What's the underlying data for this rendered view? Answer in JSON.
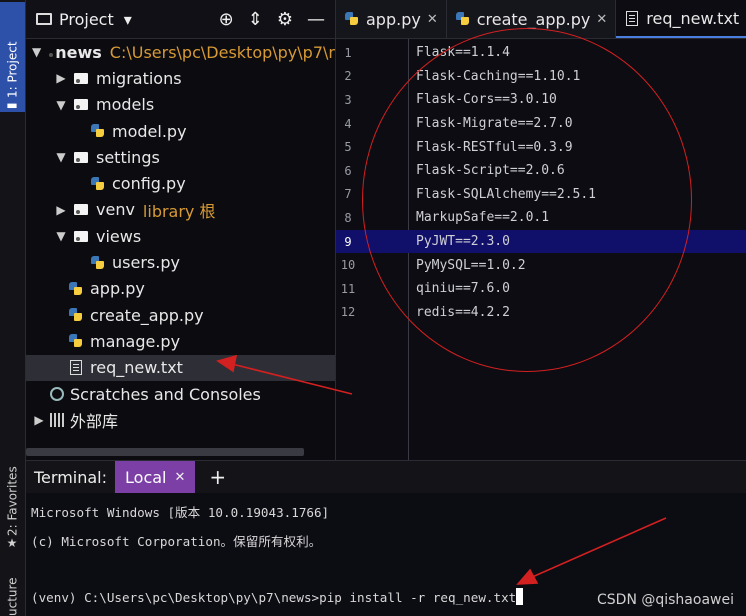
{
  "sidebar_strip": {
    "project_tab": "1: Project",
    "favorites_tab": "2: Favorites",
    "structure_tab": "ucture"
  },
  "project_panel": {
    "title": "Project",
    "dropdown_glyph": "▾",
    "tree": [
      {
        "name": "news",
        "path": "C:\\Users\\pc\\Desktop\\py\\p7\\n",
        "kind": "root",
        "expanded": true,
        "depth": 0
      },
      {
        "name": "migrations",
        "kind": "folder",
        "expanded": false,
        "depth": 1
      },
      {
        "name": "models",
        "kind": "folder",
        "expanded": true,
        "depth": 1
      },
      {
        "name": "model.py",
        "kind": "py",
        "depth": 2
      },
      {
        "name": "settings",
        "kind": "folder",
        "expanded": true,
        "depth": 1
      },
      {
        "name": "config.py",
        "kind": "py",
        "depth": 2
      },
      {
        "name": "venv",
        "note": "library 根",
        "kind": "folder",
        "expanded": false,
        "depth": 1
      },
      {
        "name": "views",
        "kind": "folder",
        "expanded": true,
        "depth": 1
      },
      {
        "name": "users.py",
        "kind": "py",
        "depth": 2
      },
      {
        "name": "app.py",
        "kind": "py",
        "depth": 1
      },
      {
        "name": "create_app.py",
        "kind": "py",
        "depth": 1
      },
      {
        "name": "manage.py",
        "kind": "py",
        "depth": 1
      },
      {
        "name": "req_new.txt",
        "kind": "txt",
        "depth": 1,
        "selected": true
      },
      {
        "name": "Scratches and Consoles",
        "kind": "scratch",
        "depth": 0
      },
      {
        "name": "外部库",
        "kind": "lib",
        "expanded": false,
        "depth": 0
      }
    ]
  },
  "editor_tabs": [
    {
      "label": "app.py",
      "icon": "python-file-icon",
      "active": false
    },
    {
      "label": "create_app.py",
      "icon": "python-file-icon",
      "active": false
    },
    {
      "label": "req_new.txt",
      "icon": "text-file-icon",
      "active": true
    }
  ],
  "editor": {
    "current_line": 9,
    "lines": [
      {
        "num": "1",
        "text": "Flask==1.1.4"
      },
      {
        "num": "2",
        "text": "Flask-Caching==1.10.1"
      },
      {
        "num": "3",
        "text": "Flask-Cors==3.0.10"
      },
      {
        "num": "4",
        "text": "Flask-Migrate==2.7.0"
      },
      {
        "num": "5",
        "text": "Flask-RESTful==0.3.9"
      },
      {
        "num": "6",
        "text": "Flask-Script==2.0.6"
      },
      {
        "num": "7",
        "text": "Flask-SQLAlchemy==2.5.1"
      },
      {
        "num": "8",
        "text": "MarkupSafe==2.0.1"
      },
      {
        "num": "9",
        "text": "PyJWT==2.3.0"
      },
      {
        "num": "10",
        "text": "PyMySQL==1.0.2"
      },
      {
        "num": "11",
        "text": "qiniu==7.6.0"
      },
      {
        "num": "12",
        "text": "redis==4.2.2"
      }
    ]
  },
  "terminal": {
    "label": "Terminal:",
    "tab": "Local",
    "add": "+",
    "lines": [
      "Microsoft Windows [版本 10.0.19043.1766]",
      "(c) Microsoft Corporation。保留所有权利。"
    ],
    "prompt": "(venv) C:\\Users\\pc\\Desktop\\py\\p7\\news>pip install -r req_new.txt"
  },
  "watermark": "CSDN @qishaoawei",
  "colors": {
    "selection": "#10106a",
    "terminal_tab": "#7b3fa6",
    "annotation": "#d32020",
    "path": "#d79a35"
  }
}
